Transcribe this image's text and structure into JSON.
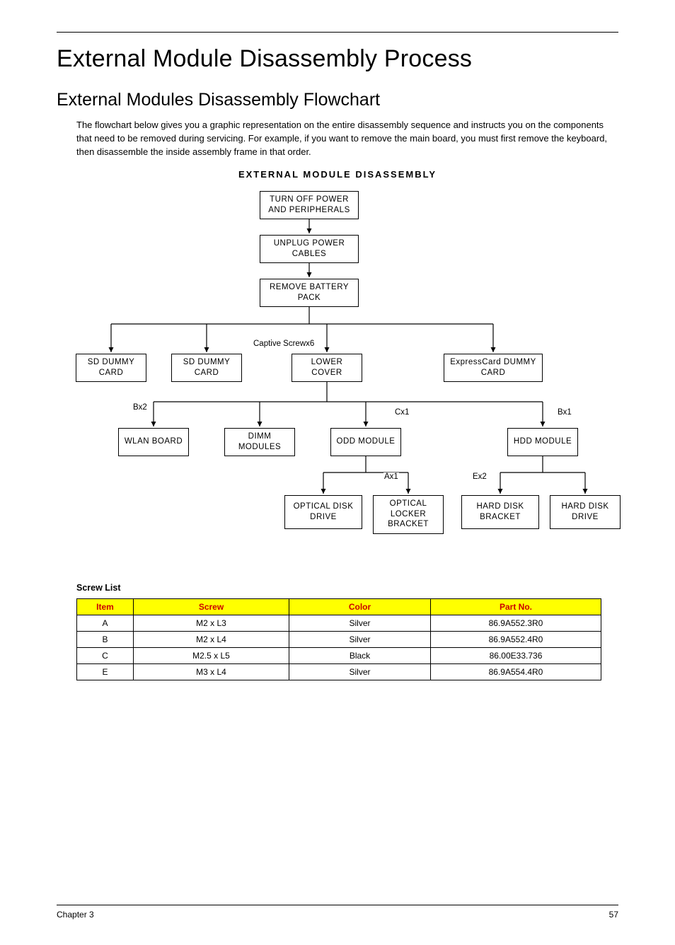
{
  "page": {
    "title": "External Module Disassembly Process",
    "subtitle": "External Modules Disassembly Flowchart",
    "intro": "The flowchart below gives you a graphic representation on the entire disassembly sequence and instructs you on the components that need to be removed during servicing. For example, if you want to remove the main board, you must first remove the keyboard, then disassemble the inside assembly frame in that order.",
    "diagram_title": "EXTERNAL MODULE DISASSEMBLY"
  },
  "flowchart": {
    "nodes": {
      "power_off": "TURN OFF POWER AND PERIPHERALS",
      "unplug": "UNPLUG POWER CABLES",
      "battery": "REMOVE BATTERY PACK",
      "sd_dummy_1": "SD DUMMY CARD",
      "sd_dummy_2": "SD DUMMY CARD",
      "lower_cover": "LOWER COVER",
      "express_dummy": "ExpressCard DUMMY CARD",
      "wlan": "WLAN BOARD",
      "dimm": "DIMM MODULES",
      "odd_module": "ODD MODULE",
      "hdd_module": "HDD MODULE",
      "optical_drive": "OPTICAL DISK DRIVE",
      "optical_bracket": "OPTICAL LOCKER BRACKET",
      "hdd_bracket": "HARD DISK BRACKET",
      "hdd_drive": "HARD DISK DRIVE"
    },
    "edge_labels": {
      "captive": "Captive Screwx6",
      "bx2": "Bx2",
      "cx1": "Cx1",
      "bx1": "Bx1",
      "ax1": "Ax1",
      "ex2": "Ex2"
    }
  },
  "screw_list": {
    "heading": "Screw List",
    "headers": {
      "item": "Item",
      "screw": "Screw",
      "color": "Color",
      "part": "Part No."
    },
    "rows": [
      {
        "item": "A",
        "screw": "M2 x L3",
        "color": "Silver",
        "part": "86.9A552.3R0"
      },
      {
        "item": "B",
        "screw": "M2 x L4",
        "color": "Silver",
        "part": "86.9A552.4R0"
      },
      {
        "item": "C",
        "screw": "M2.5 x L5",
        "color": "Black",
        "part": "86.00E33.736"
      },
      {
        "item": "E",
        "screw": "M3 x L4",
        "color": "Silver",
        "part": "86.9A554.4R0"
      }
    ]
  },
  "footer": {
    "chapter": "Chapter 3",
    "page_no": "57"
  },
  "chart_data": {
    "type": "table",
    "title": "Screw List",
    "columns": [
      "Item",
      "Screw",
      "Color",
      "Part No."
    ],
    "rows": [
      [
        "A",
        "M2 x L3",
        "Silver",
        "86.9A552.3R0"
      ],
      [
        "B",
        "M2 x L4",
        "Silver",
        "86.9A552.4R0"
      ],
      [
        "C",
        "M2.5 x L5",
        "Black",
        "86.00E33.736"
      ],
      [
        "E",
        "M3 x L4",
        "Silver",
        "86.9A554.4R0"
      ]
    ]
  }
}
